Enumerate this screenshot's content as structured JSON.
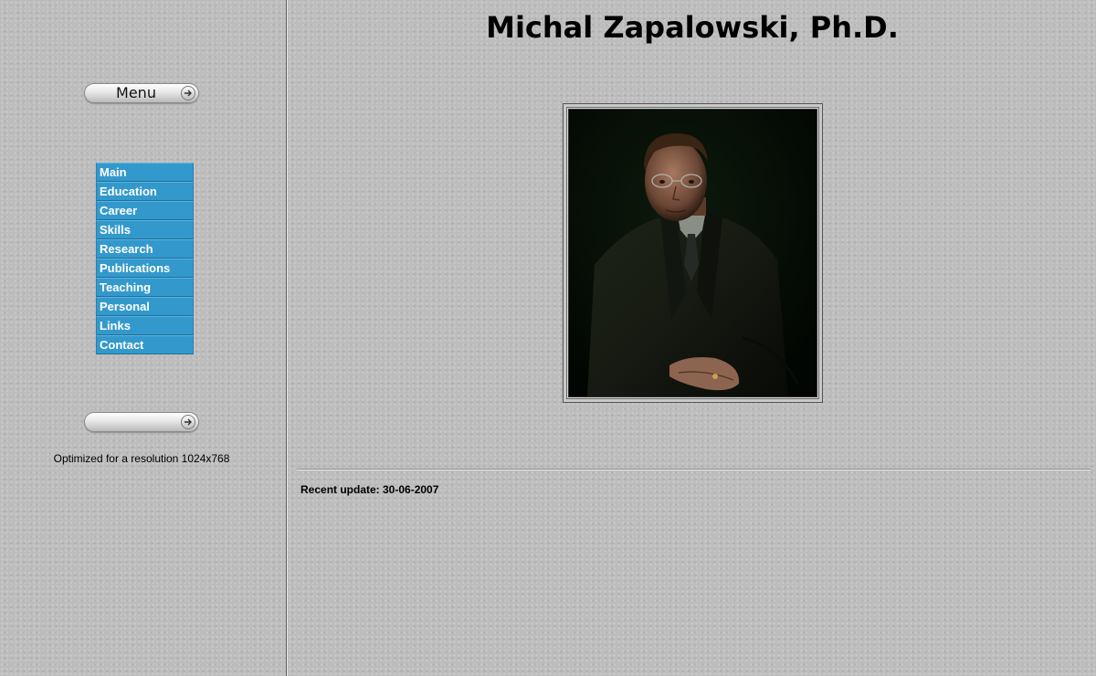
{
  "page": {
    "title": "Michal Zapalowski, Ph.D.",
    "photo_subject": "portrait of man in dark suit"
  },
  "sidebar": {
    "menu_button_label": "Menu",
    "menu_button_icon": "arrow-right-icon",
    "second_button_label": "",
    "second_button_icon": "arrow-right-icon",
    "nav_items": [
      {
        "label": "Main"
      },
      {
        "label": "Education"
      },
      {
        "label": "Career"
      },
      {
        "label": "Skills"
      },
      {
        "label": "Research"
      },
      {
        "label": "Publications"
      },
      {
        "label": "Teaching"
      },
      {
        "label": "Personal"
      },
      {
        "label": "Links"
      },
      {
        "label": "Contact"
      }
    ],
    "resolution_note": "Optimized for a resolution 1024x768"
  },
  "footer": {
    "recent_update": "Recent update: 30-06-2007"
  },
  "colors": {
    "background": "#bdbdbd",
    "nav_item_bg": "#3399cc",
    "nav_item_text": "#ffffff",
    "photo_bg": "#030a03"
  }
}
